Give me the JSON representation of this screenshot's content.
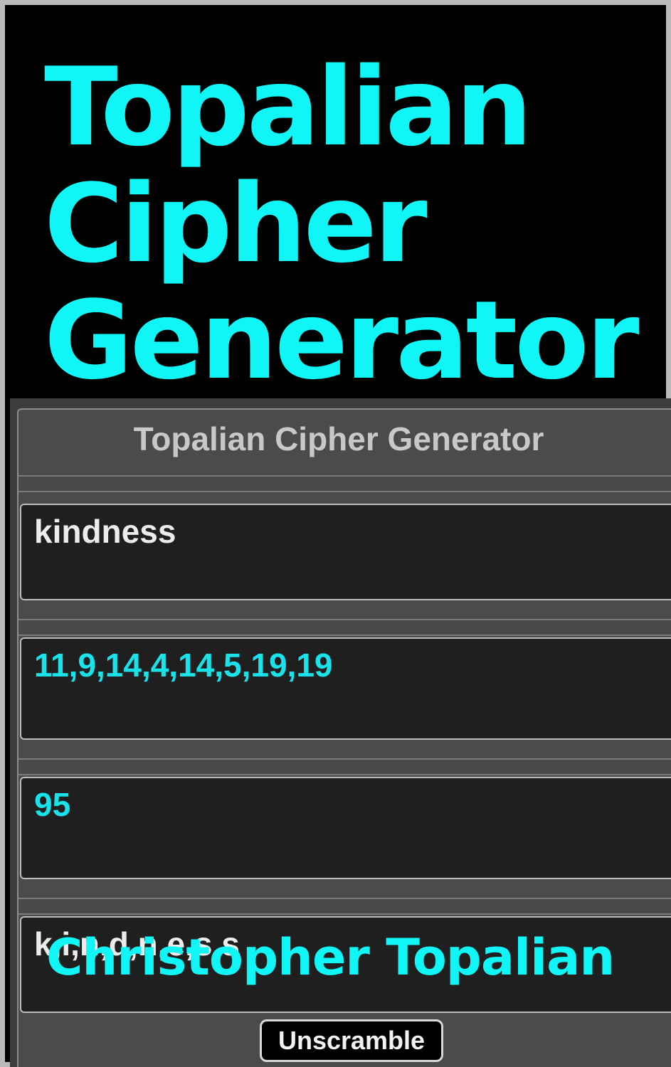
{
  "cover": {
    "title_lines": [
      "Topalian",
      "Cipher",
      "Generator"
    ],
    "author": "Christopher Topalian"
  },
  "app": {
    "title": "Topalian Cipher Generator",
    "input_text": "kindness",
    "numbers_output": "11,9,14,4,14,5,19,19",
    "sum_output": "95",
    "scrambled_output": "k,i,n,d,n,e,s,s",
    "unscramble_label": "Unscramble"
  },
  "colors": {
    "accent": "#10f6f6",
    "panel": "#4b4b4b",
    "field": "#1f1f1f"
  }
}
